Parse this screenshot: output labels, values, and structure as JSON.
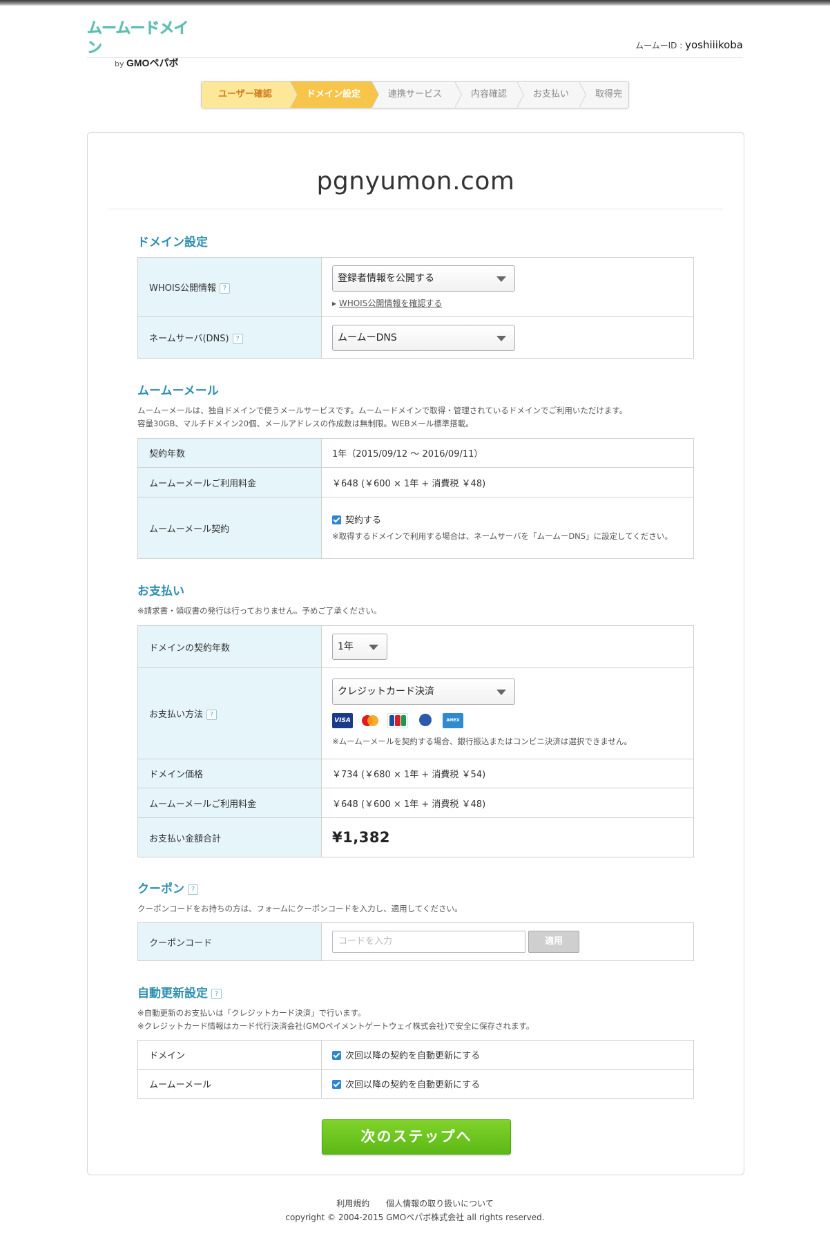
{
  "header": {
    "logo_text": "ムームードメイン",
    "logo_by": "by",
    "logo_company": "GMOペパボ",
    "user_id_label": "ムームーID :",
    "user_id": "yoshiiikoba"
  },
  "steps": [
    "ユーザー確認",
    "ドメイン設定",
    "連携サービス",
    "内容確認",
    "お支払い",
    "取得完了"
  ],
  "domain": "pgnyumon.com",
  "domain_settings": {
    "heading": "ドメイン設定",
    "whois_label": "WHOIS公開情報",
    "whois_value": "登録者情報を公開する",
    "whois_link": "WHOIS公開情報を確認する",
    "ns_label": "ネームサーバ(DNS)",
    "ns_value": "ムームーDNS"
  },
  "mail": {
    "heading": "ムームーメール",
    "desc1": "ムームーメールは、独自ドメインで使うメールサービスです。ムームードメインで取得・管理されているドメインでご利用いただけます。",
    "desc2": "容量30GB、マルチドメイン20個、メールアドレスの作成数は無制限。WEBメール標準搭載。",
    "term_label": "契約年数",
    "term_value": "1年（2015/09/12 〜 2016/09/11）",
    "fee_label": "ムームーメールご利用料金",
    "fee_value": "￥648 (￥600 × 1年 + 消費税 ￥48)",
    "contract_label": "ムームーメール契約",
    "contract_check": "契約する",
    "contract_note": "※取得するドメインで利用する場合は、ネームサーバを「ムームーDNS」に設定してください。"
  },
  "payment": {
    "heading": "お支払い",
    "note": "※請求書・領収書の発行は行っておりません。予めご了承ください。",
    "years_label": "ドメインの契約年数",
    "years_value": "1年",
    "method_label": "お支払い方法",
    "method_value": "クレジットカード決済",
    "card_icons": [
      "VISA",
      "MasterCard",
      "JCB",
      "Diners Club",
      "AMERICAN EXPRESS"
    ],
    "method_note": "※ムームーメールを契約する場合、銀行振込またはコンビニ決済は選択できません。",
    "domain_price_label": "ドメイン価格",
    "domain_price_value": "￥734 (￥680 × 1年 + 消費税 ￥54)",
    "mail_fee_label": "ムームーメールご利用料金",
    "mail_fee_value": "￥648 (￥600 × 1年 + 消費税 ￥48)",
    "total_label": "お支払い金額合計",
    "total_value": "¥1,382"
  },
  "coupon": {
    "heading": "クーポン",
    "note": "クーポンコードをお持ちの方は、フォームにクーポンコードを入力し、適用してください。",
    "label": "クーポンコード",
    "placeholder": "コードを入力",
    "apply": "適用"
  },
  "auto_renew": {
    "heading": "自動更新設定",
    "note1": "※自動更新のお支払いは「クレジットカード決済」で行います。",
    "note2": "※クレジットカード情報はカード代行決済会社(GMOペイメントゲートウェイ株式会社)で安全に保存されます。",
    "domain_label": "ドメイン",
    "domain_check": "次回以降の契約を自動更新にする",
    "mail_label": "ムームーメール",
    "mail_check": "次回以降の契約を自動更新にする"
  },
  "next_button": "次のステップへ",
  "footer": {
    "terms": "利用規約",
    "privacy": "個人情報の取り扱いについて",
    "copyright": "copyright © 2004-2015 GMOペパボ株式会社 all rights reserved."
  },
  "help_mark": "?",
  "colors": {
    "accent": "#2d8fb0",
    "step_done": "#fde89a",
    "step_current": "#f6c54a",
    "label_bg": "#e5f5fa",
    "next_button": "#6cc41f"
  }
}
